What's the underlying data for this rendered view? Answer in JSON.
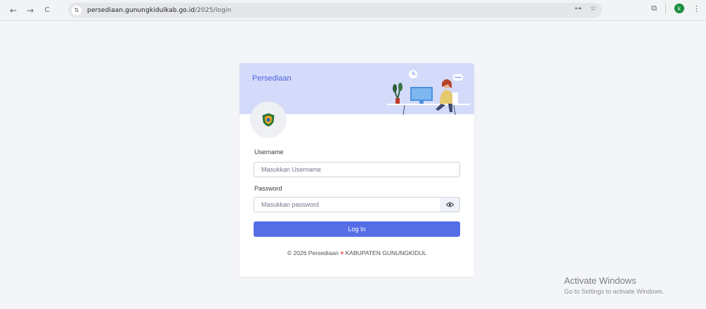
{
  "browser": {
    "back_icon": "←",
    "forward_icon": "→",
    "reload_icon": "C",
    "site_info_icon": "⇅",
    "url_domain": "persediaan.gunungkidulkab.go.id",
    "url_path": "/2025/login",
    "password_key_icon": "⊶",
    "star_icon": "☆",
    "extensions_icon": "⧉",
    "profile_initial": "k",
    "menu_icon": "⋮"
  },
  "card": {
    "app_name": "Persediaan",
    "username_label": "Username",
    "username_placeholder": "Masukkan Username",
    "password_label": "Password",
    "password_placeholder": "Masukkan password",
    "login_button": "Log In",
    "footer_prefix": "© 2026 Persediaan",
    "footer_heart": "♥",
    "footer_suffix": "KABUPATEN GUNUNGKIDUL"
  },
  "watermark": {
    "title": "Activate Windows",
    "subtitle": "Go to Settings to activate Windows."
  },
  "colors": {
    "primary": "#556ee6",
    "header_bg": "#d4dbfa",
    "page_bg": "#f4f5f8"
  }
}
